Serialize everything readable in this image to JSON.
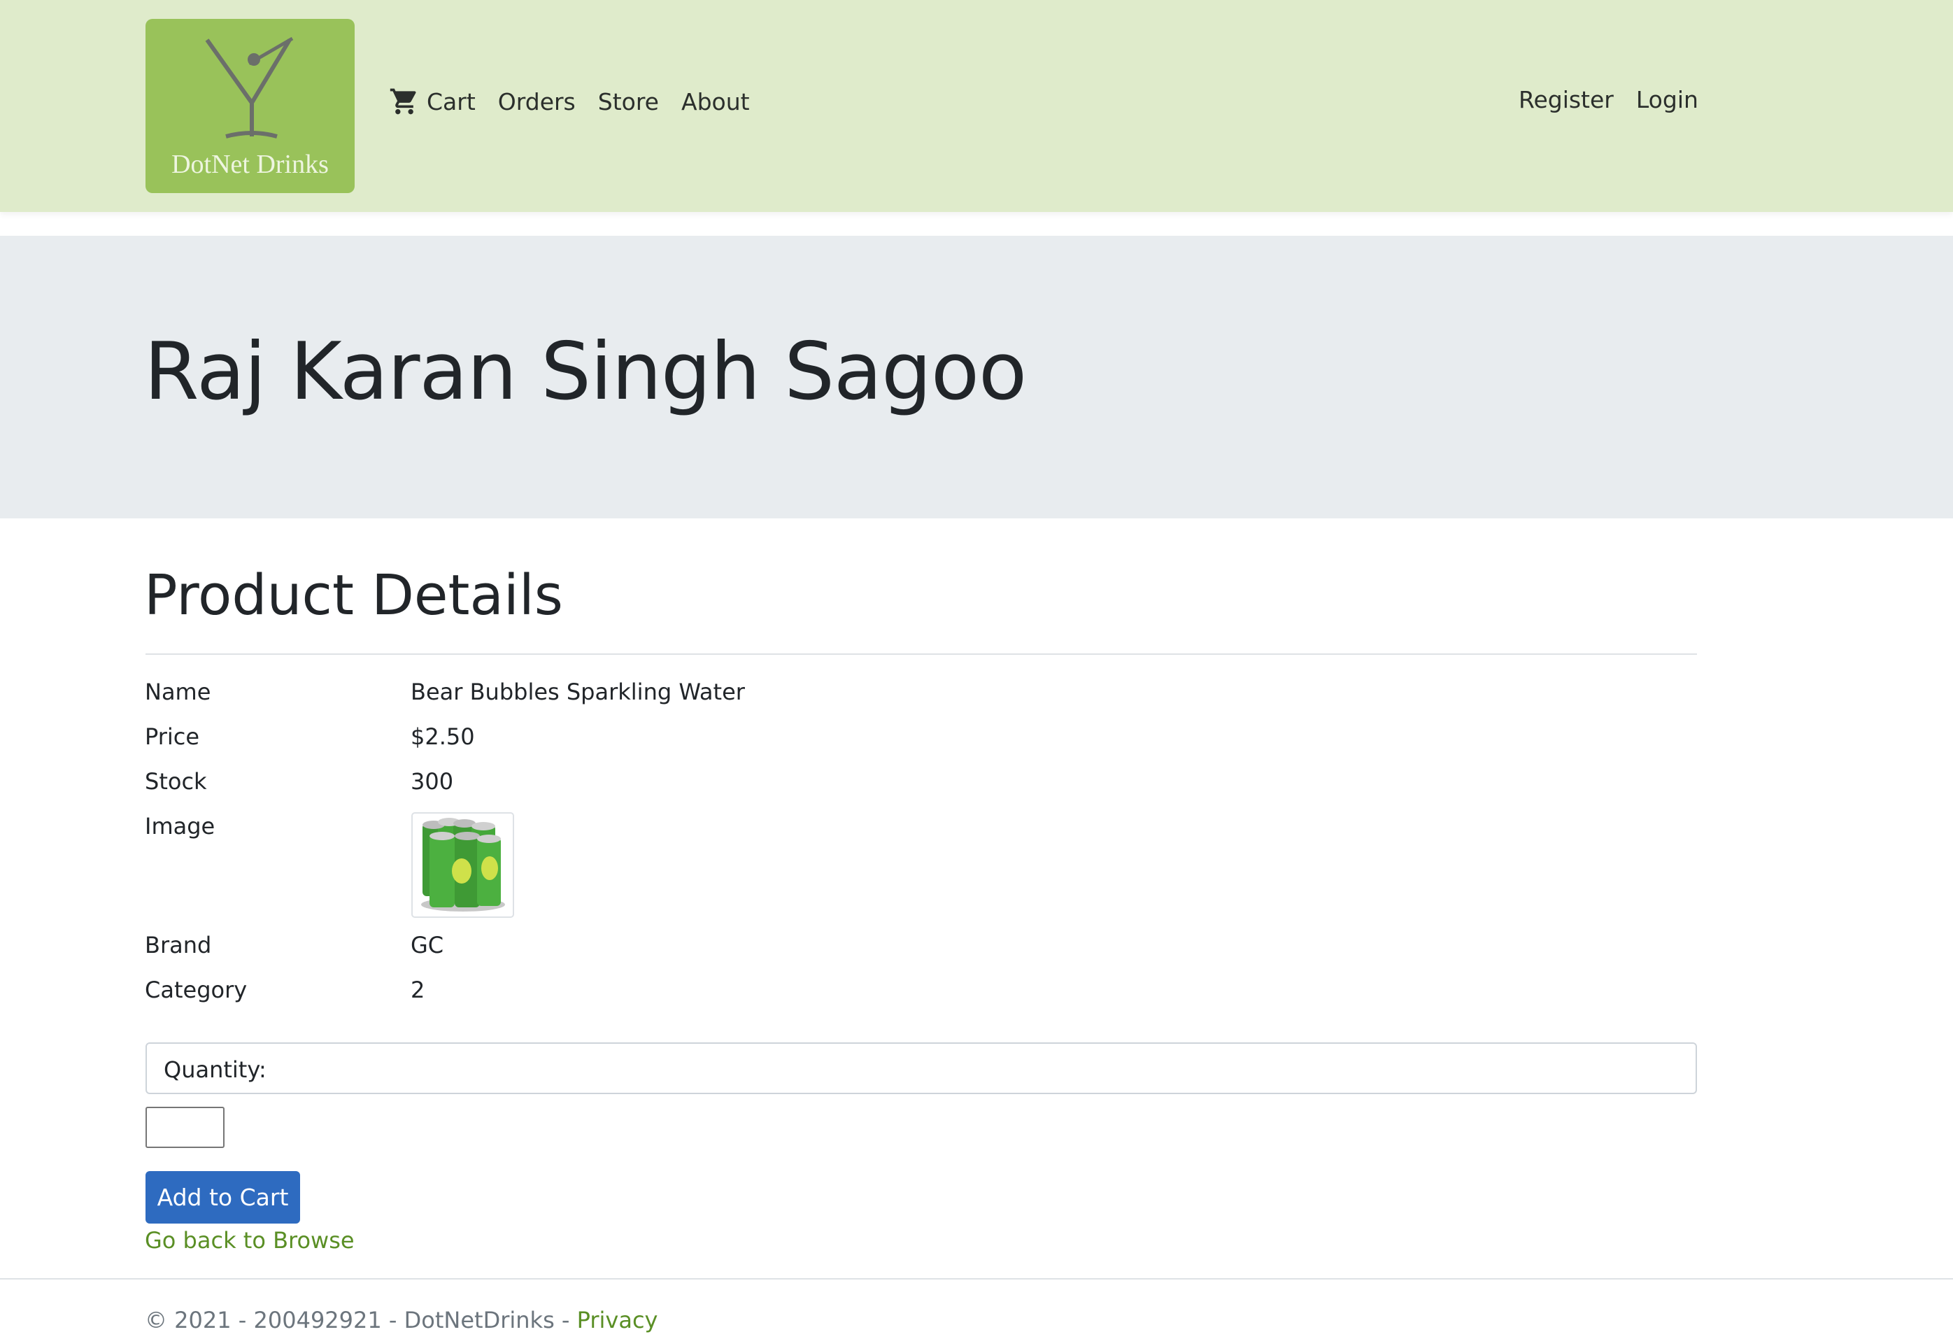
{
  "nav": {
    "brand": "DotNet Drinks",
    "left": [
      {
        "label": "Cart",
        "icon": "cart-icon"
      },
      {
        "label": "Orders"
      },
      {
        "label": "Store"
      },
      {
        "label": "About"
      }
    ],
    "right": [
      {
        "label": "Register"
      },
      {
        "label": "Login"
      }
    ]
  },
  "jumbotron": {
    "title": "Raj Karan Singh Sagoo"
  },
  "details": {
    "heading": "Product Details",
    "rows": [
      {
        "label": "Name",
        "value": "Bear Bubbles Sparkling Water"
      },
      {
        "label": "Price",
        "value": "$2.50"
      },
      {
        "label": "Stock",
        "value": "300"
      },
      {
        "label": "Image",
        "value": ""
      },
      {
        "label": "Brand",
        "value": "GC"
      },
      {
        "label": "Category",
        "value": "2"
      }
    ],
    "image_icon": "green-cans-icon"
  },
  "form": {
    "quantity_label": "Quantity:",
    "quantity_value": "",
    "add_button": "Add to Cart",
    "back_link": "Go back to Browse"
  },
  "footer": {
    "text": "© 2021 - 200492921 - DotNetDrinks - ",
    "privacy": "Privacy"
  },
  "colors": {
    "navbar_bg": "#dfebcb",
    "logo_bg": "#99c25a",
    "jumbotron_bg": "#e8ecef",
    "primary_button": "#2e6bc0",
    "link": "#5a8f25"
  }
}
